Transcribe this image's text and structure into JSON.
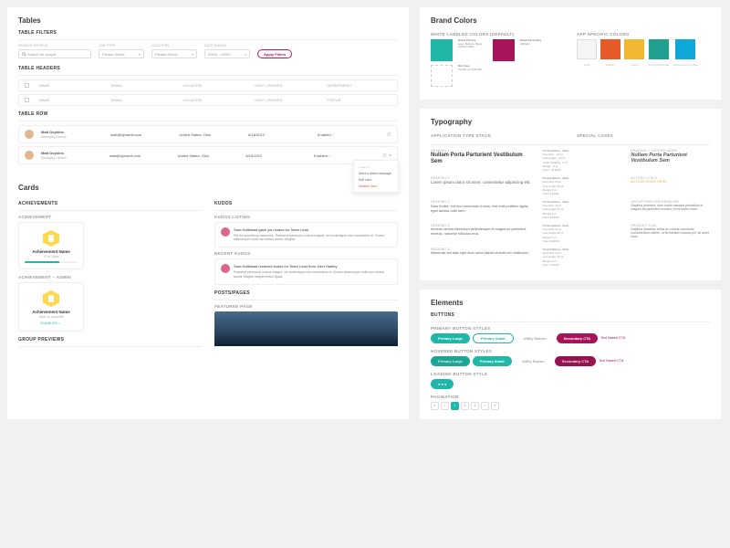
{
  "tables": {
    "title": "Tables",
    "filters_h": "Table Filters",
    "headers_h": "Table Headers",
    "row_h": "Table Row",
    "filters": {
      "search": {
        "label": "Search People",
        "placeholder": "Search for people"
      },
      "job": {
        "label": "Job Type",
        "value": "Please Select"
      },
      "location": {
        "label": "Location",
        "value": "Please Select"
      },
      "date": {
        "label": "Date Range",
        "value": "00/00 – 00/00"
      },
      "apply": "Apply Filters"
    },
    "columns1": [
      "Name",
      "Email",
      "Location",
      "Date Created",
      "Department"
    ],
    "columns2": [
      "Name",
      "Email",
      "Location",
      "Date Created",
      "Status"
    ],
    "rows": [
      {
        "name": "Matt Doykins",
        "role": "Managing Partner",
        "email": "matt@dynamit.com",
        "location": "United States, Ohio",
        "date": "8/16/2012",
        "status": "Enabled"
      },
      {
        "name": "Matt Doykins",
        "role": "Managing Partner",
        "email": "matt@dynamit.com",
        "location": "United States, Ohio",
        "date": "8/16/2012",
        "status": "Enabled"
      }
    ],
    "menu": {
      "head": "I want to...",
      "m1": "Send a direct message",
      "m2": "Edit User",
      "m3": "Disable User"
    }
  },
  "cards": {
    "title": "Cards",
    "ach_h": "Achievements",
    "ach_label": "Achievement",
    "ach_admin": "Achievement – Admin",
    "ach": {
      "name": "Achievement Name",
      "sub": "12 of 18pts"
    },
    "ach2": {
      "name": "Achievement Name",
      "sub": "18pts to complete",
      "enabled": "ENABLED"
    },
    "group_h": "Group Previews",
    "kudos_h": "Kudos",
    "kudos_label": "Kudos Listing",
    "recent_label": "Recent Kudos",
    "k1": {
      "head": "Sara Hallstead gave you kudos for Team Lead",
      "body": "Pid dui something awesome. Praesent commodo cursus magna, vel scelerisque nisl consectetur et. Donec ullamcorper nulla non metus auctor fringilla."
    },
    "k2": {
      "head": "Sara Hallstead received kudos for Team Lead from John Hartley",
      "body": "Praesent commodo cursus magna, vel scelerisque nisl consectetur et. Donec ullamcorper nulla non metus auctor fringilla magna metus ligula."
    },
    "posts_h": "Posts/Pages",
    "featured": "Featured Page"
  },
  "brand": {
    "title": "Brand Colors",
    "white_h": "White Labeled Colors (Default)",
    "app_h": "App Specific Colors",
    "wl": [
      {
        "hex": "#1fb8a8",
        "name": "Brand Primary",
        "sub": "Logo, Buttons,\nBrand H1/Secondary"
      },
      {
        "hex": "#a8145a",
        "name": "Brand Secondary",
        "sub": "AB Dark"
      },
      {
        "hex": "",
        "name": "Nav Case",
        "sub": "Primary tint shift 25%",
        "border": true
      }
    ],
    "app": [
      {
        "hex": "#f5f5f5",
        "label": "Light"
      },
      {
        "hex": "#e85a2a",
        "label": "Primary"
      },
      {
        "hex": "#f4b731",
        "label": "Yellow"
      },
      {
        "hex": "#1fa090",
        "label": "Success Emerald"
      },
      {
        "hex": "#0fa8d8",
        "label": "Application Link Blue"
      }
    ]
  },
  "typo": {
    "title": "Typography",
    "stack_h": "Application Type Stack",
    "special_h": "Special cases",
    "h1_lbl": "Heading 1",
    "h1": "Nullam Porta Parturient Vestibulum Sem",
    "h2_lbl": "Heading 2",
    "h2": "Lorem ipsum dolor sit amet, consectetur adipiscing elit.",
    "h3_lbl": "Heading 3",
    "h3": "Duis mollis, est non commodo luctus, nisi erat porttitor ligula, eget lacinia odio sem.",
    "h4_lbl": "Heading 4",
    "h4": "Aenean lacinia bibendum pellentesque et magna au parturient montus, nascetur ridiculus mus.",
    "h5_lbl": "Heading 5",
    "h5": "Maecenas sed diam eget risus varius blandit sit amet non vestibulum.",
    "font": "ProximaNova - Bold",
    "spec": {
      "fs": "Font Size",
      "lh": "Line Height",
      "ls": "Letter Spacing",
      "mg": "Margin",
      "co": "Color"
    },
    "vals1": {
      "fs": "24 pt",
      "lh": "30 pt",
      "ls": "0 pt",
      "mg": "0 pt",
      "co": "414b56"
    },
    "sc_h1": "Heading 1: Editing Mode",
    "sc1": "Nullam Porta Parturient Vestibulum Sem",
    "sc_act_lbl": "Action / CTA's",
    "sc_act": "Action goes here",
    "sc_grp": "Group Preview Headline",
    "sc_grp_t": "Dapibus pharetra, dum sociis natoque penatibus et magna dis parturient montes, et mi lorem maur.",
    "sc_prod": "Product Link",
    "sc_prod_t": "Dapibus pharetra, tellus ac cursus commodo condimentum nibhm, ut fermentum massa prit, sit amet risus."
  },
  "elements": {
    "title": "Elements",
    "buttons_h": "Buttons",
    "primary_lbl": "Primary Button Styles",
    "hover_lbl": "Hovered Button Styles",
    "loading_lbl": "Loading Button Style",
    "b_lg": "Primary Large",
    "b_sm": "Primary Small",
    "b_util": "Utility Button",
    "b_sec": "Secondary CTA",
    "b_txt": "Text Based CTA",
    "pag_h": "Pagination",
    "pages": [
      "«",
      "‹",
      "1",
      "2",
      "3",
      "›",
      "»"
    ],
    "active_page": 2
  }
}
